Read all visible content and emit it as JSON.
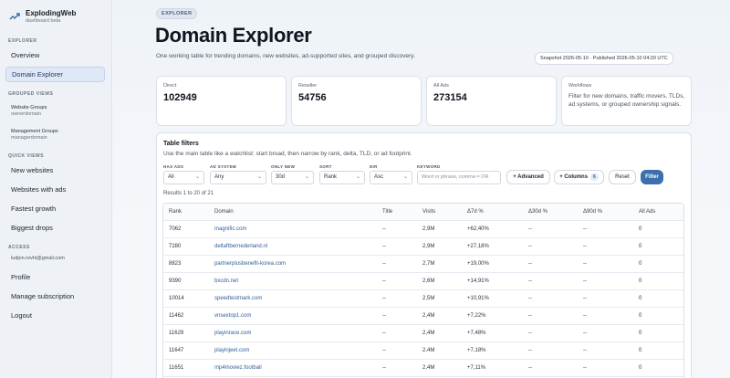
{
  "brand": {
    "name": "ExplodingWeb",
    "subtitle": "dashboard beta"
  },
  "sidebar": {
    "explorer_label": "EXPLORER",
    "explorer_items": [
      {
        "label": "Overview",
        "active": false
      },
      {
        "label": "Domain Explorer",
        "active": true
      }
    ],
    "grouped_label": "GROUPED VIEWS",
    "grouped_items": [
      {
        "label": "Website Groups",
        "sub": "ownerdomain"
      },
      {
        "label": "Management Groups",
        "sub": "managerdomain"
      }
    ],
    "quick_label": "QUICK VIEWS",
    "quick_items": [
      "New websites",
      "Websites with ads",
      "Fastest growth",
      "Biggest drops"
    ],
    "access_label": "ACCESS",
    "access_email": "ludjon.rovhi@gmail.com",
    "access_items": [
      "Profile",
      "Manage subscription",
      "Logout"
    ]
  },
  "header": {
    "pill": "EXPLORER",
    "title": "Domain Explorer",
    "subtitle": "One working table for trending domains, new websites, ad-supported sites, and grouped discovery.",
    "snapshot": "Snapshot 2026-05-10 · Published 2026-05-10 04:20 UTC"
  },
  "cards": [
    {
      "label": "Direct",
      "value": "102949"
    },
    {
      "label": "Reseller",
      "value": "54756"
    },
    {
      "label": "All Ads",
      "value": "273154"
    }
  ],
  "workflows": {
    "label": "Workflows",
    "text": "Filter for new domains, traffic movers, TLDs, ad systems, or grouped ownership signals."
  },
  "filters": {
    "title": "Table filters",
    "description": "Use the main table like a watchlist: start broad, then narrow by rank, delta, TLD, or ad footprint.",
    "has_ads": {
      "label": "HAS ADS",
      "value": "All"
    },
    "ad_system": {
      "label": "AD SYSTEM",
      "value": "Any"
    },
    "only_new": {
      "label": "ONLY NEW",
      "value": "30d"
    },
    "sort": {
      "label": "SORT",
      "value": "Rank"
    },
    "dir": {
      "label": "DIR",
      "value": "Asc"
    },
    "keyword": {
      "label": "KEYWORD",
      "placeholder": "Word or phrase, comma = OR"
    },
    "advanced": "+ Advanced",
    "columns": "+ Columns",
    "columns_count": "6",
    "reset": "Reset",
    "filter": "Filter"
  },
  "results": "Results 1 to 20 of 21",
  "table": {
    "headers": [
      "Rank",
      "Domain",
      "Title",
      "Visits",
      "Δ7d %",
      "Δ30d %",
      "Δ90d %",
      "All Ads"
    ],
    "rows": [
      [
        "7062",
        "magnific.com",
        "--",
        "2,9M",
        "+62,40%",
        "--",
        "--",
        "0"
      ],
      [
        "7280",
        "deltaftbernederland.nl",
        "--",
        "2,9M",
        "+27,18%",
        "--",
        "--",
        "0"
      ],
      [
        "8823",
        "partnerplusbenefit-korea.com",
        "--",
        "2,7M",
        "+19,00%",
        "--",
        "--",
        "0"
      ],
      [
        "9390",
        "bxcdn.net",
        "--",
        "2,6M",
        "+14,91%",
        "--",
        "--",
        "0"
      ],
      [
        "10014",
        "speedtestmark.com",
        "--",
        "2,5M",
        "+10,91%",
        "--",
        "--",
        "0"
      ],
      [
        "11462",
        "vnsextop1.com",
        "--",
        "2,4M",
        "+7,22%",
        "--",
        "--",
        "0"
      ],
      [
        "11629",
        "playinrace.com",
        "--",
        "2,4M",
        "+7,48%",
        "--",
        "--",
        "0"
      ],
      [
        "11647",
        "playinjeet.com",
        "--",
        "2,4M",
        "+7,18%",
        "--",
        "--",
        "0"
      ],
      [
        "11651",
        "mp4moviez.football",
        "--",
        "2,4M",
        "+7,11%",
        "--",
        "--",
        "0"
      ]
    ]
  }
}
